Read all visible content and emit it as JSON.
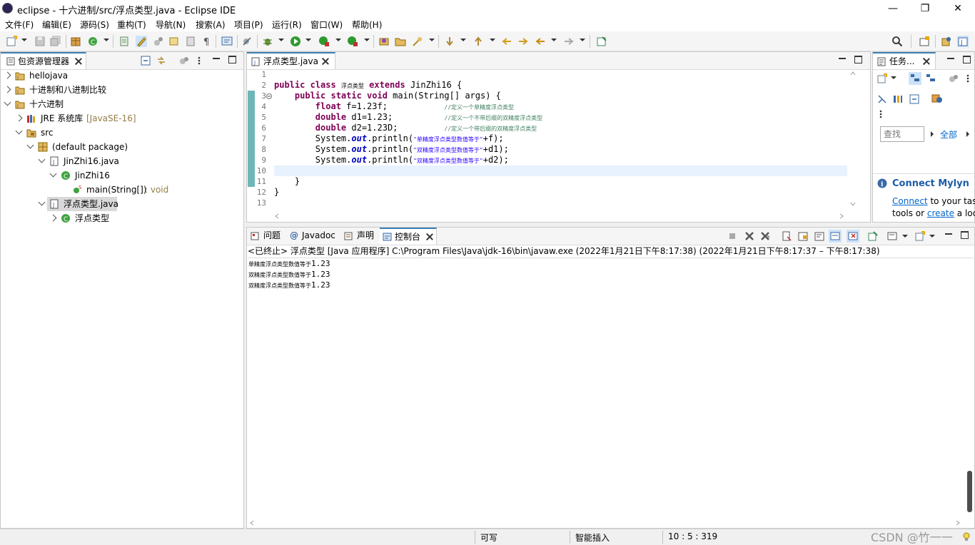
{
  "window": {
    "title": "eclipse - 十六进制/src/浮点类型.java - Eclipse IDE",
    "minimize": "—",
    "restore": "❐",
    "close": "✕"
  },
  "menu": [
    "文件(F)",
    "编辑(E)",
    "源码(S)",
    "重构(T)",
    "导航(N)",
    "搜索(A)",
    "项目(P)",
    "运行(R)",
    "窗口(W)",
    "帮助(H)"
  ],
  "package_explorer": {
    "tab_label": "包资源管理器",
    "tree": [
      {
        "label": "hellojava",
        "suffix": ""
      },
      {
        "label": "十进制和八进制比较",
        "suffix": ""
      },
      {
        "label": "十六进制",
        "suffix": ""
      },
      {
        "label": "JRE 系统库",
        "suffix": "[JavaSE-16]"
      },
      {
        "label": "src",
        "suffix": ""
      },
      {
        "label": "(default package)",
        "suffix": ""
      },
      {
        "label": "JinZhi16.java",
        "suffix": ""
      },
      {
        "label": "JinZhi16",
        "suffix": ""
      },
      {
        "label": "main(String[])",
        "suffix": ": void"
      },
      {
        "label": "浮点类型.java",
        "suffix": ""
      },
      {
        "label": "浮点类型",
        "suffix": ""
      }
    ]
  },
  "editor": {
    "tab_label": "浮点类型.java",
    "line_numbers": [
      "1",
      "2",
      "3",
      "4",
      "5",
      "6",
      "7",
      "8",
      "9",
      "10",
      "11",
      "12",
      "13"
    ],
    "code": {
      "l2_kw": "public class ",
      "l2_cn": "浮点类型",
      "l2_kw2": " extends",
      "l2_rest": " JinZhi16 {",
      "l3_kw": "    public static void",
      "l3_rest": " main(String[] args) {",
      "l4_kw": "        float",
      "l4_rest": " f=1.23f;           ",
      "l4_cm": "//定义一个单精度浮点类型",
      "l5_kw": "        double",
      "l5_rest": " d1=1.23;          ",
      "l5_cm": "//定义一个不带后缀的双精度浮点类型",
      "l6_kw": "        double",
      "l6_rest": " d2=1.23D;         ",
      "l6_cm": "//定义一个带后缀的双精度浮点类型",
      "l7_a": "        System.",
      "l7_fld": "out",
      "l7_b": ".println(",
      "l7_str": "\"单精度浮点类型数值等于\"",
      "l7_c": "+f);",
      "l8_a": "        System.",
      "l8_fld": "out",
      "l8_b": ".println(",
      "l8_str": "\"双精度浮点类型数值等于\"",
      "l8_c": "+d1);",
      "l9_a": "        System.",
      "l9_fld": "out",
      "l9_b": ".println(",
      "l9_str": "\"双精度浮点类型数值等于\"",
      "l9_c": "+d2);",
      "l11": "    }",
      "l12": "}"
    }
  },
  "task_panel": {
    "tab_label": "任务...",
    "find_placeholder": "查找",
    "all_label": "全部",
    "mylyn_title": "Connect Mylyn",
    "mylyn_connect": "Connect",
    "mylyn_text1": " to your task and ALM",
    "mylyn_text2": "tools or ",
    "mylyn_create": "create",
    "mylyn_text3": " a local task."
  },
  "bottom_tabs": [
    {
      "label": "问题",
      "icon": "problems-icon"
    },
    {
      "label": "Javadoc",
      "icon": "javadoc-icon"
    },
    {
      "label": "声明",
      "icon": "declaration-icon"
    },
    {
      "label": "控制台",
      "icon": "console-icon"
    }
  ],
  "console": {
    "header": "<已终止> 浮点类型 [Java 应用程序] C:\\Program Files\\Java\\jdk-16\\bin\\javaw.exe  (2022年1月21日下午8:17:38)   (2022年1月21日下午8:17:37 – 下午8:17:38)",
    "lines": [
      {
        "text": "单精度浮点类型数值等于",
        "value": "1.23"
      },
      {
        "text": "双精度浮点类型数值等于",
        "value": "1.23"
      },
      {
        "text": "双精度浮点类型数值等于",
        "value": "1.23"
      }
    ]
  },
  "statusbar": {
    "writable": "可写",
    "insert_mode": "智能插入",
    "position": "10 : 5 : 319",
    "watermark": "CSDN @竹一一"
  },
  "colors": {
    "keyword": "#7f0055",
    "comment": "#3f7f5f",
    "string": "#2a00ff",
    "field": "#0000c0",
    "link": "#0066cc",
    "mylyn": "#1c5ca8"
  }
}
